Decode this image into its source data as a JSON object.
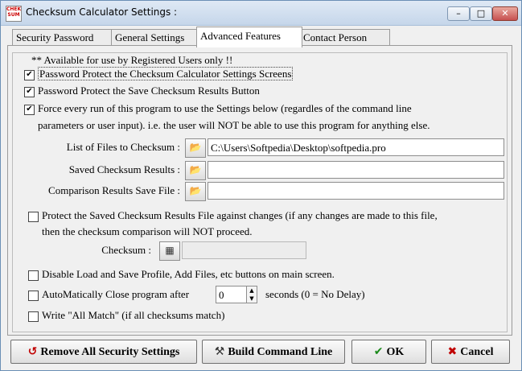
{
  "window": {
    "title": "Checksum Calculator Settings :",
    "app_icon_text": [
      "CHEK",
      "SUM"
    ],
    "min_glyph": "–",
    "max_glyph": "□",
    "close_glyph": "✕"
  },
  "tabs": [
    {
      "label": "Security Password",
      "active": false
    },
    {
      "label": "General Settings",
      "active": false
    },
    {
      "label": "Advanced Features",
      "active": true
    },
    {
      "label": "Contact Person",
      "active": false
    }
  ],
  "group": {
    "label": "** Available for use by Registered Users only !!"
  },
  "options": {
    "protect_settings": {
      "label": "Password Protect the Checksum Calculator Settings Screens",
      "checked": true
    },
    "protect_save": {
      "label": "Password Protect the Save Checksum Results Button",
      "checked": true
    },
    "force_settings": {
      "label_line1": "Force every run of this program to use the Settings below (regardles of the command line",
      "label_line2": "parameters or user input).  i.e. the user will NOT be able to use this program for anything else.",
      "checked": true
    },
    "protect_file": {
      "label_line1": "Protect the Saved Checksum Results File against changes (if any changes are made to this file,",
      "label_line2": "then the checksum comparison will NOT proceed.",
      "checked": false
    },
    "disable_load": {
      "label": "Disable Load and Save Profile, Add Files, etc buttons on main screen.",
      "checked": false
    },
    "auto_close": {
      "label": "AutoMatically Close program after",
      "suffix": "seconds (0 = No Delay)",
      "value": "0",
      "checked": false
    },
    "write_all_match": {
      "label": "Write \"All Match\" (if all checksums match)",
      "checked": false
    }
  },
  "fields": {
    "files_list": {
      "label": "List of Files to Checksum :",
      "value": "C:\\Users\\Softpedia\\Desktop\\softpedia.pro"
    },
    "saved_results": {
      "label": "Saved Checksum Results :",
      "value": ""
    },
    "comparison_save": {
      "label": "Comparison Results Save File :",
      "value": ""
    },
    "checksum": {
      "label": "Checksum :",
      "value": ""
    }
  },
  "icons": {
    "folder": "📂",
    "calculator": "▦",
    "spin_up": "▲",
    "spin_down": "▼",
    "check": "✔"
  },
  "buttons": {
    "remove_security": {
      "label": "Remove All Security Settings",
      "icon": "↺",
      "icon_color": "#c00000"
    },
    "build_cmd": {
      "label": "Build Command Line",
      "icon": "⚒",
      "icon_color": "#333333"
    },
    "ok": {
      "label": "OK",
      "icon": "✔",
      "icon_color": "#1a8a1a"
    },
    "cancel": {
      "label": "Cancel",
      "icon": "✖",
      "icon_color": "#c00000"
    }
  }
}
